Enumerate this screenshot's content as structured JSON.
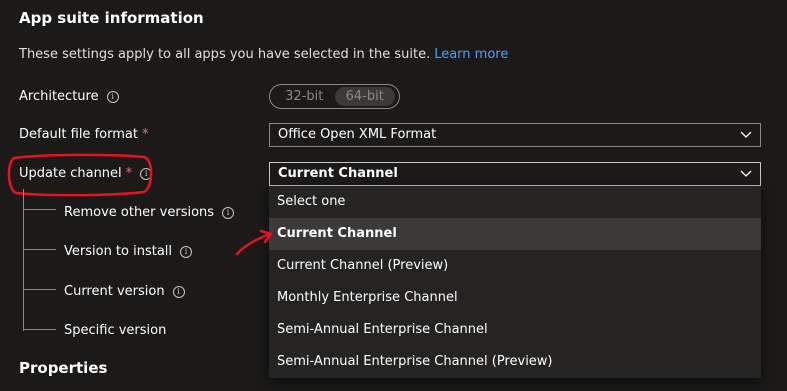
{
  "section": {
    "title": "App suite information",
    "description": "These settings apply to all apps you have selected in the suite.",
    "learn_more": "Learn more"
  },
  "architecture": {
    "label": "Architecture",
    "options": [
      "32-bit",
      "64-bit"
    ],
    "selected": "64-bit"
  },
  "file_format": {
    "label": "Default file format",
    "required_mark": "*",
    "value": "Office Open XML Format"
  },
  "update_channel": {
    "label": "Update channel",
    "required_mark": "*",
    "value": "Current Channel",
    "options": [
      "Select one",
      "Current Channel",
      "Current Channel (Preview)",
      "Monthly Enterprise Channel",
      "Semi-Annual Enterprise Channel",
      "Semi-Annual Enterprise Channel (Preview)"
    ]
  },
  "sub_settings": {
    "remove_other_versions": "Remove other versions",
    "version_to_install": "Version to install",
    "current_version": "Current version",
    "specific_version": "Specific version"
  },
  "properties": {
    "title": "Properties"
  },
  "icons": {
    "info": "info-icon",
    "chevron": "chevron-down-icon"
  },
  "colors": {
    "background": "#1b1a19",
    "link": "#4aa0f5",
    "required": "#f1707b",
    "annotation": "#e81123"
  }
}
